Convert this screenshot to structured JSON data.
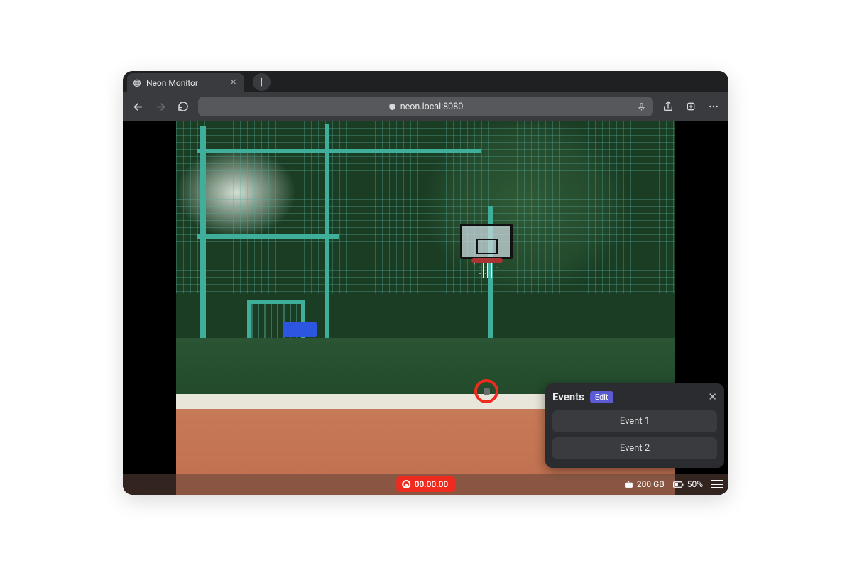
{
  "browser": {
    "tab_title": "Neon Monitor",
    "url_display": "neon.local:8080"
  },
  "recording": {
    "timecode": "00.00.00"
  },
  "status": {
    "storage": "200 GB",
    "battery": "50%"
  },
  "events_panel": {
    "title": "Events",
    "edit_label": "Edit",
    "items": [
      "Event 1",
      "Event 2"
    ]
  }
}
